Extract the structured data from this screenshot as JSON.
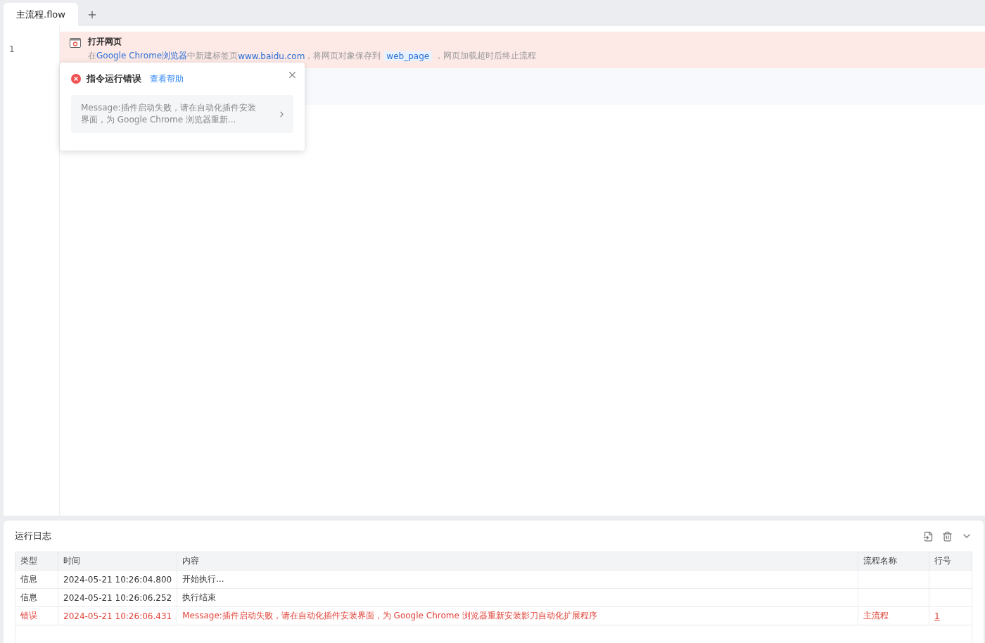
{
  "tabs": [
    {
      "label": "主流程.flow",
      "selected": true
    }
  ],
  "editor": {
    "lines": [
      {
        "number": "1",
        "title": "打开网页",
        "error": true,
        "description": [
          {
            "kind": "text",
            "text": "在"
          },
          {
            "kind": "link",
            "text": "Google Chrome浏览器"
          },
          {
            "kind": "text",
            "text": "中新建标签页"
          },
          {
            "kind": "link",
            "text": "www.baidu.com"
          },
          {
            "kind": "text",
            "text": "，将网页对象保存到"
          },
          {
            "kind": "variable",
            "text": "web_page"
          },
          {
            "kind": "text",
            "text": "，网页加载超时后终止流程"
          }
        ]
      }
    ]
  },
  "error_popup": {
    "title": "指令运行错误",
    "help_link": "查看帮助",
    "message": "Message:插件启动失败，请在自动化插件安装界面，为 Google Chrome 浏览器重新..."
  },
  "log": {
    "title": "运行日志",
    "columns": [
      "类型",
      "时间",
      "内容",
      "流程名称",
      "行号"
    ],
    "rows": [
      {
        "kind": "info",
        "type": "信息",
        "time": "2024-05-21 10:26:04.800",
        "content": "开始执行..."
      },
      {
        "kind": "info",
        "type": "信息",
        "time": "2024-05-21 10:26:06.252",
        "content": "执行结束"
      },
      {
        "kind": "error",
        "type": "错误",
        "time": "2024-05-21 10:26:06.431",
        "content": "Message:插件启动失败，请在自动化插件安装界面，为 Google Chrome 浏览器重新安装影刀自动化扩展程序",
        "flow": "主流程",
        "line": "1"
      }
    ]
  }
}
